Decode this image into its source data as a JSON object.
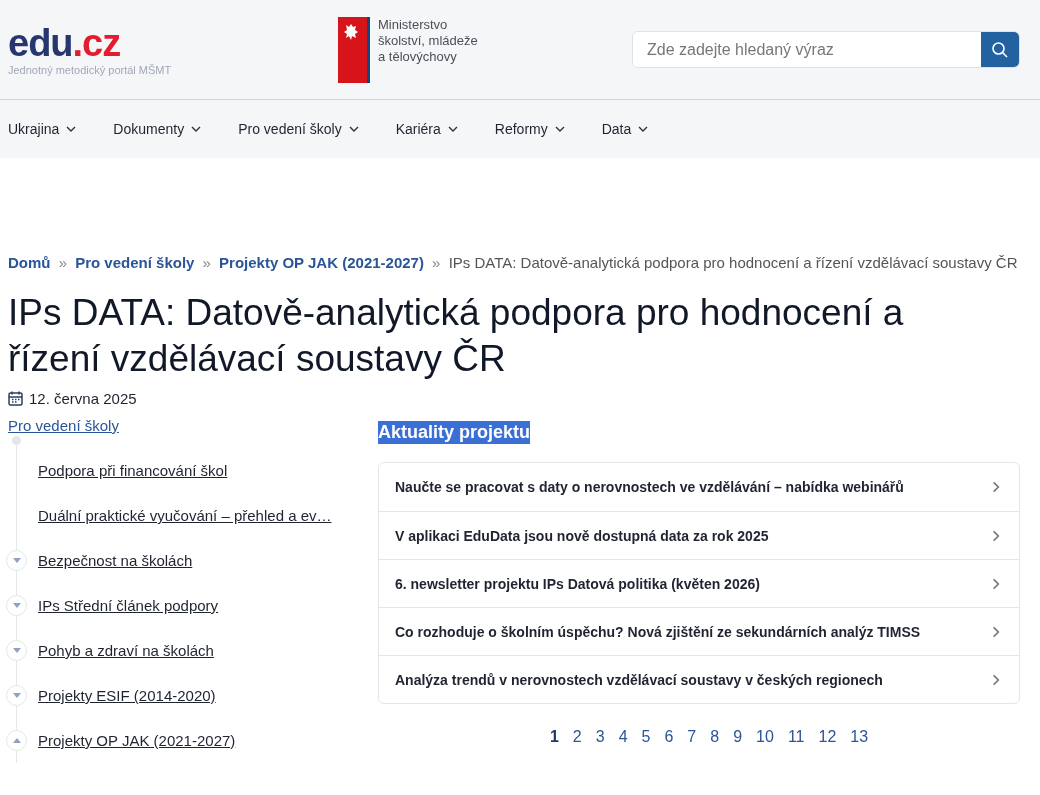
{
  "header": {
    "logo": {
      "main": "edu",
      "suffix": ".cz",
      "tagline": "Jednotný metodický portál MŠMT"
    },
    "ministry": {
      "lines": [
        "Ministerstvo",
        "školství, mládeže",
        "a tělovýchovy"
      ]
    },
    "search": {
      "placeholder": "Zde zadejte hledaný výraz"
    }
  },
  "nav": [
    {
      "label": "Ukrajina"
    },
    {
      "label": "Dokumenty"
    },
    {
      "label": "Pro vedení školy"
    },
    {
      "label": "Kariéra"
    },
    {
      "label": "Reformy"
    },
    {
      "label": "Data"
    }
  ],
  "breadcrumb": {
    "links": [
      "Domů",
      "Pro vedení školy",
      "Projekty OP JAK (2021-2027)"
    ],
    "separator": "»",
    "current": "IPs DATA: Datově-analytická podpora pro hodnocení a řízení vzdělávací soustavy ČR"
  },
  "title": "IPs DATA: Datově-analytická podpora pro hodnocení a řízení vzdělávací soustavy ČR",
  "date": "12. června 2025",
  "sidebar": {
    "parent": "Pro vedení školy",
    "items": [
      {
        "label": "Podpora při financování škol",
        "kind": "leaf"
      },
      {
        "label": "Duální praktické vyučování – přehled a ev…",
        "kind": "leaf"
      },
      {
        "label": "Bezpečnost na školách",
        "kind": "branch",
        "expanded": false
      },
      {
        "label": "IPs Střední článek podpory",
        "kind": "branch",
        "expanded": false
      },
      {
        "label": "Pohyb a zdraví na školách",
        "kind": "branch",
        "expanded": false
      },
      {
        "label": "Projekty ESIF (2014-2020)",
        "kind": "branch",
        "expanded": false
      },
      {
        "label": "Projekty OP JAK (2021-2027)",
        "kind": "branch",
        "expanded": true
      }
    ]
  },
  "news": {
    "heading": "Aktuality projektu",
    "items": [
      "Naučte se pracovat s daty o nerovnostech ve vzdělávání – nabídka webinářů",
      "V aplikaci EduData jsou nově dostupná data za rok 2025",
      "6. newsletter projektu IPs Datová politika (květen 2026)",
      "Co rozhoduje o školním úspěchu? Nová zjištění ze sekundárních analýz TIMSS",
      "Analýza trendů v nerovnostech vzdělávací soustavy v českých regionech"
    ]
  },
  "pagination": [
    {
      "label": "1",
      "selected": true
    },
    {
      "label": "2",
      "selected": false
    },
    {
      "label": "3",
      "selected": false
    },
    {
      "label": "4",
      "selected": false
    },
    {
      "label": "5",
      "selected": false
    },
    {
      "label": "6",
      "selected": false
    },
    {
      "label": "7",
      "selected": false
    },
    {
      "label": "8",
      "selected": false
    },
    {
      "label": "9",
      "selected": false
    },
    {
      "label": "10",
      "selected": false
    },
    {
      "label": "11",
      "selected": false
    },
    {
      "label": "12",
      "selected": false
    },
    {
      "label": "13",
      "selected": false
    }
  ]
}
